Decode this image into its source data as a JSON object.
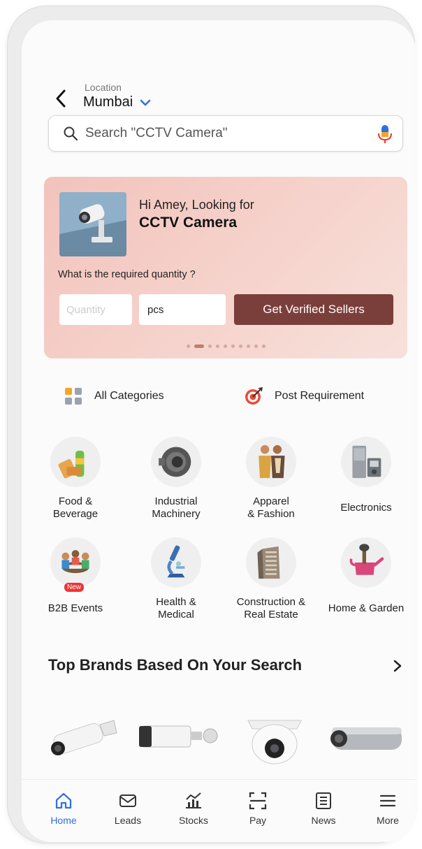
{
  "header": {
    "location_label": "Location",
    "city": "Mumbai"
  },
  "search": {
    "placeholder": "Search \"CCTV Camera\""
  },
  "banner": {
    "greeting": "Hi Amey, Looking for",
    "product": "CCTV Camera",
    "quantity_question": "What is the required quantity ?",
    "quantity_placeholder": "Quantity",
    "unit": "pcs",
    "cta_label": "Get Verified Sellers",
    "carousel_total": 10,
    "carousel_active": 1
  },
  "quick_actions": {
    "all_categories": "All Categories",
    "post_requirement": "Post Requirement"
  },
  "categories": [
    {
      "label": "Food &\nBeverage",
      "icon": "food-beverage-icon"
    },
    {
      "label": "Industrial\nMachinery",
      "icon": "industrial-machinery-icon"
    },
    {
      "label": "Apparel\n& Fashion",
      "icon": "apparel-fashion-icon"
    },
    {
      "label": "Electronics",
      "icon": "electronics-icon"
    },
    {
      "label": "B2B Events",
      "icon": "b2b-events-icon",
      "badge": "New"
    },
    {
      "label": "Health &\nMedical",
      "icon": "health-medical-icon"
    },
    {
      "label": "Construction &\nReal Estate",
      "icon": "construction-real-estate-icon"
    },
    {
      "label": "Home & Garden",
      "icon": "home-garden-icon"
    }
  ],
  "brands": {
    "title": "Top Brands Based On Your Search"
  },
  "bottom_nav": [
    {
      "label": "Home",
      "icon": "home-icon",
      "active": true
    },
    {
      "label": "Leads",
      "icon": "mail-icon",
      "active": false
    },
    {
      "label": "Stocks",
      "icon": "stocks-chart-icon",
      "active": false
    },
    {
      "label": "Pay",
      "icon": "scan-icon",
      "active": false
    },
    {
      "label": "News",
      "icon": "news-icon",
      "active": false
    },
    {
      "label": "More",
      "icon": "menu-icon",
      "active": false
    }
  ],
  "colors": {
    "accent": "#2f6fe0",
    "cta": "#7a3f3b",
    "banner": "#f2c3bc"
  }
}
